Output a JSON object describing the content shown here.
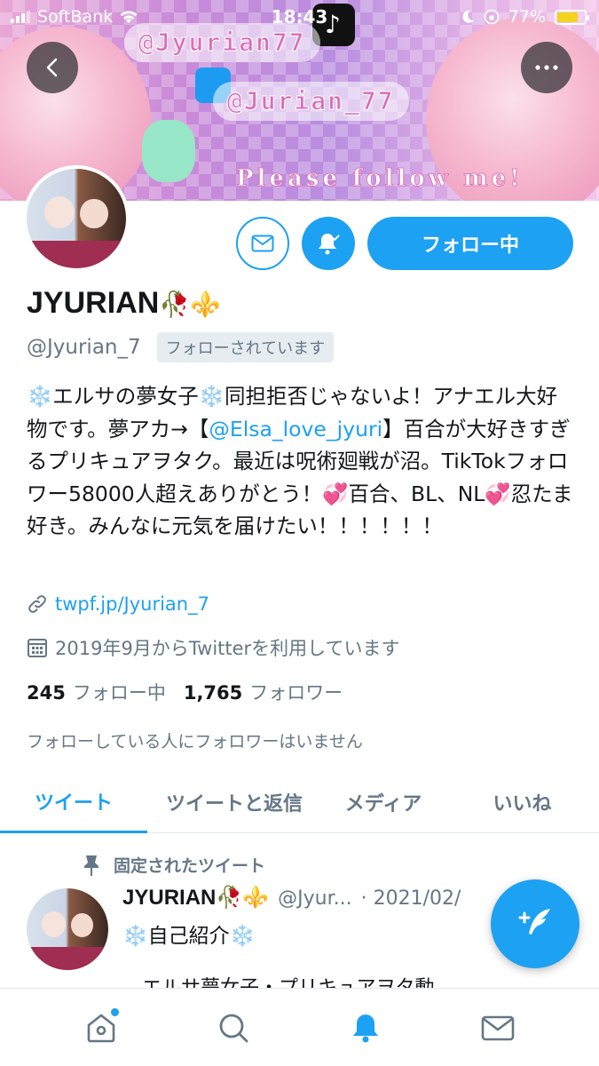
{
  "status_bar": {
    "carrier": "SoftBank",
    "time": "18:43",
    "battery": "77%"
  },
  "banner": {
    "tiktok_handle": "@Jyurian77",
    "twitter_handle": "@Jurian_77",
    "caption": "Please follow me!"
  },
  "profile": {
    "name": "JYURIAN",
    "name_emoji": "🥀⚜️",
    "handle": "@Jyurian_7",
    "follows_you": "フォローされています",
    "follow_button": "フォロー中",
    "bio_1": "❄️エルサの夢女子❄️同担拒否じゃないよ！アナエル大好物です。夢アカ→【",
    "bio_mention": "@Elsa_love_jyuri",
    "bio_2": "】百合が大好きすぎるプリキュアヲタク。最近は呪術廻戦が沼。TikTokフォロワー58000人超えありがとう！💞百合、BL、NL💞忍たま好き。みんなに元気を届けたい！！！！！！",
    "link": "twpf.jp/Jyurian_7",
    "joined": "2019年9月からTwitterを利用しています",
    "following_count": "245",
    "following_label": "フォロー中",
    "followers_count": "1,765",
    "followers_label": "フォロワー",
    "no_mutual": "フォローしている人にフォロワーはいません"
  },
  "tabs": [
    "ツイート",
    "ツイートと返信",
    "メディア",
    "いいね"
  ],
  "pinned": {
    "label": "固定されたツイート",
    "name": "JYURIAN🥀⚜️",
    "handle": "@Jyur...",
    "date": "· 2021/02/",
    "text": "❄️自己紹介❄️",
    "cut_text": "エルサ夢女子・プリキュアヲタ動"
  },
  "colors": {
    "accent": "#1da1f2",
    "muted": "#657786"
  },
  "icons": [
    "back-icon",
    "more-icon",
    "mail-icon",
    "bell-icon",
    "link-icon",
    "calendar-icon",
    "pin-icon",
    "compose-icon",
    "home-icon",
    "search-icon",
    "notifications-icon",
    "messages-icon"
  ]
}
